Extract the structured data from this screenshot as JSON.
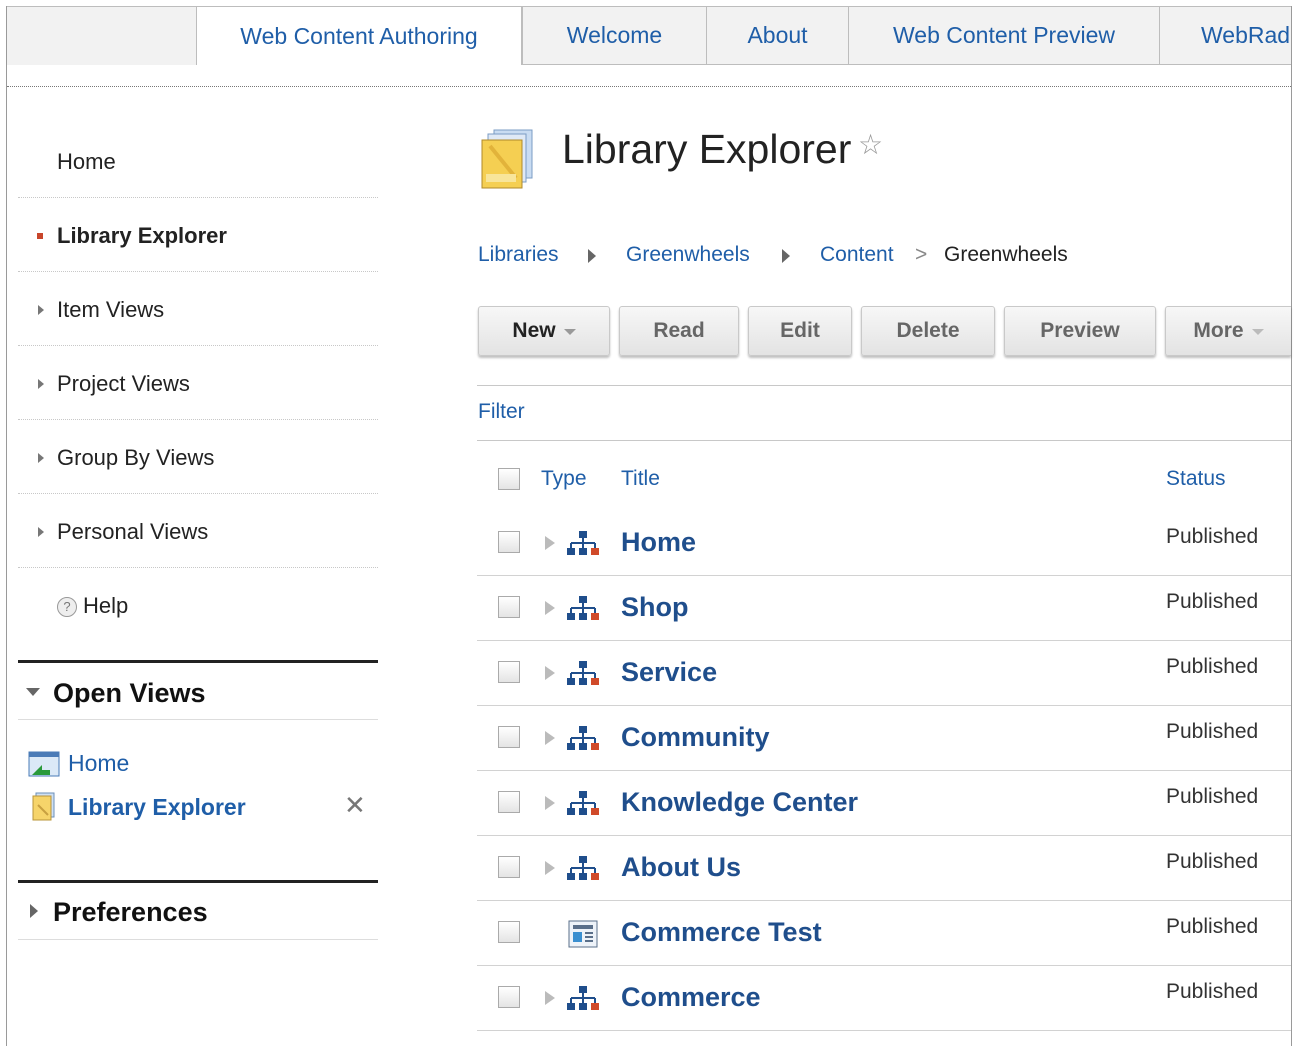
{
  "tabs": [
    {
      "label": "Web Content Authoring",
      "active": true
    },
    {
      "label": "Welcome",
      "active": false
    },
    {
      "label": "About",
      "active": false
    },
    {
      "label": "Web Content Preview",
      "active": false
    },
    {
      "label": "WebRad",
      "active": false
    }
  ],
  "sidebar": {
    "items": [
      {
        "label": "Home",
        "marker": "none"
      },
      {
        "label": "Library Explorer",
        "marker": "selected"
      },
      {
        "label": "Item Views",
        "marker": "expand"
      },
      {
        "label": "Project Views",
        "marker": "expand"
      },
      {
        "label": "Group By Views",
        "marker": "expand"
      },
      {
        "label": "Personal Views",
        "marker": "expand"
      },
      {
        "label": "Help",
        "marker": "help-icon"
      }
    ],
    "open_views": {
      "title": "Open Views",
      "items": [
        {
          "label": "Home",
          "icon": "home-view-icon"
        },
        {
          "label": "Library Explorer",
          "icon": "library-explorer-icon",
          "closable": true
        }
      ]
    },
    "preferences": {
      "title": "Preferences"
    }
  },
  "main": {
    "title": "Library Explorer",
    "breadcrumb": {
      "links": [
        "Libraries",
        "Greenwheels",
        "Content"
      ],
      "separator": ">",
      "current": "Greenwheels"
    },
    "toolbar": {
      "new_label": "New",
      "read_label": "Read",
      "edit_label": "Edit",
      "delete_label": "Delete",
      "preview_label": "Preview",
      "more_label": "More"
    },
    "filter_label": "Filter",
    "table": {
      "columns": {
        "type": "Type",
        "title": "Title",
        "status": "Status"
      },
      "rows": [
        {
          "title": "Home",
          "status": "Published",
          "icon": "site-area-icon",
          "expandable": true
        },
        {
          "title": "Shop",
          "status": "Published",
          "icon": "site-area-icon",
          "expandable": true
        },
        {
          "title": "Service",
          "status": "Published",
          "icon": "site-area-icon",
          "expandable": true
        },
        {
          "title": "Community",
          "status": "Published",
          "icon": "site-area-icon",
          "expandable": true
        },
        {
          "title": "Knowledge Center",
          "status": "Published",
          "icon": "site-area-icon",
          "expandable": true
        },
        {
          "title": "About Us",
          "status": "Published",
          "icon": "site-area-icon",
          "expandable": true
        },
        {
          "title": "Commerce Test",
          "status": "Published",
          "icon": "content-item-icon",
          "expandable": false
        },
        {
          "title": "Commerce",
          "status": "Published",
          "icon": "site-area-icon",
          "expandable": true
        }
      ]
    }
  },
  "colors": {
    "link": "#1f5ea8",
    "title_link": "#1f4e8c",
    "selected_marker": "#c8452b"
  }
}
